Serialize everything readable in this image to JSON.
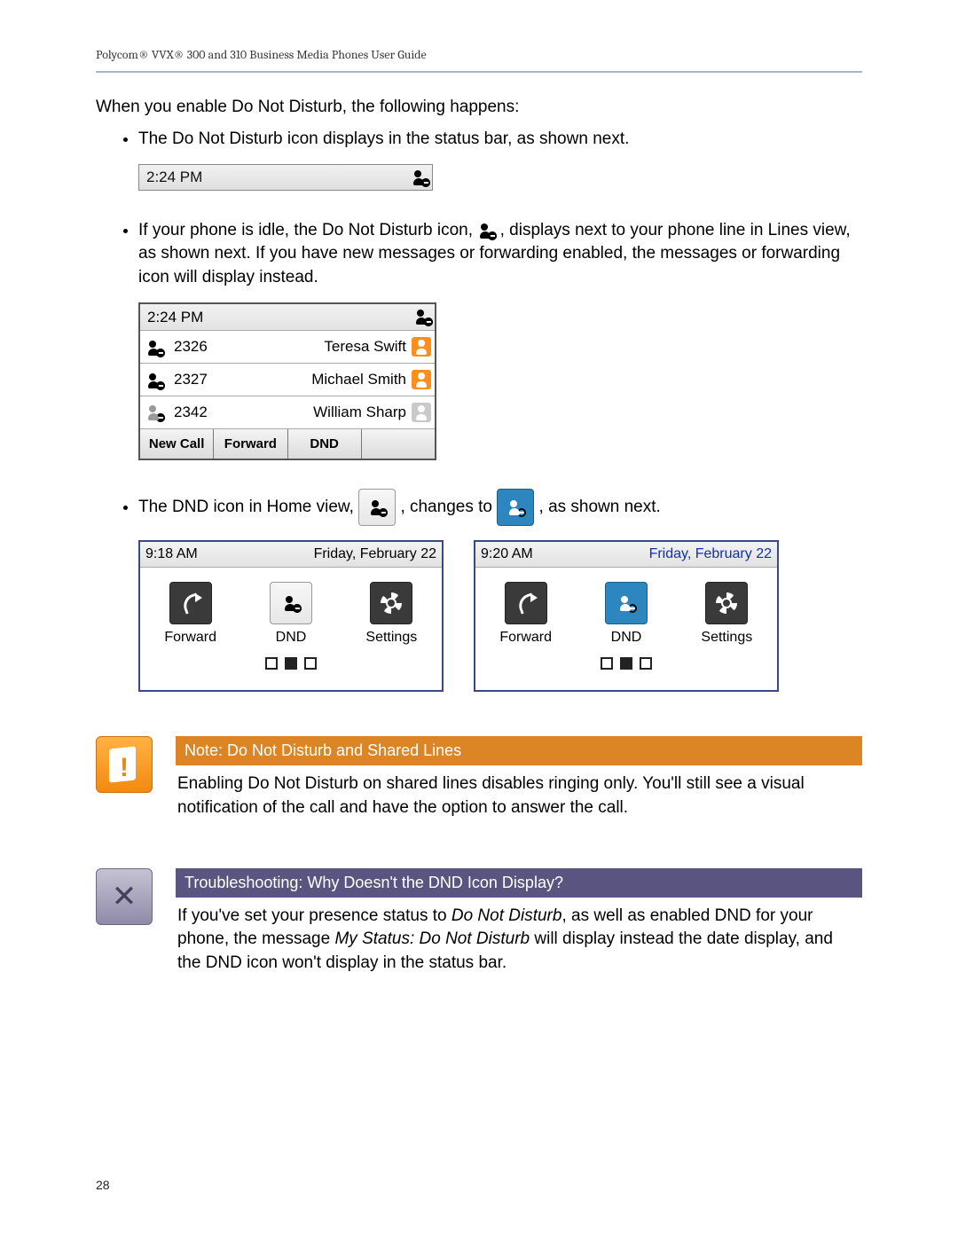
{
  "header": "Polycom® VVX® 300 and 310 Business Media Phones User Guide",
  "intro": "When you enable Do Not Disturb, the following happens:",
  "bullet1": "The Do Not Disturb icon displays in the status bar, as shown next.",
  "statusbar_time": "2:24 PM",
  "bullet2": {
    "pre": "If your phone is idle, the Do Not Disturb icon, ",
    "post": ", displays next to your phone line in Lines view, as shown next. If you have new messages or forwarding enabled, the messages or forwarding icon will display instead."
  },
  "lines_view": {
    "time": "2:24 PM",
    "rows": [
      {
        "ext": "2326",
        "name": "Teresa Swift",
        "contact_color": "orange"
      },
      {
        "ext": "2327",
        "name": "Michael Smith",
        "contact_color": "orange"
      },
      {
        "ext": "2342",
        "name": "William Sharp",
        "contact_color": "gray"
      }
    ],
    "softkeys": [
      "New Call",
      "Forward",
      "DND",
      ""
    ]
  },
  "bullet3": {
    "pre": "The DND icon in Home view, ",
    "mid": ", changes to ",
    "post": ", as shown next."
  },
  "home_left": {
    "time": "9:18 AM",
    "date": "Friday, February 22",
    "items": [
      "Forward",
      "DND",
      "Settings"
    ]
  },
  "home_right": {
    "time": "9:20 AM",
    "date": "Friday, February 22",
    "items": [
      "Forward",
      "DND",
      "Settings"
    ]
  },
  "note": {
    "title": "Note: Do Not Disturb and Shared Lines",
    "body": "Enabling Do Not Disturb on shared lines disables ringing only. You'll still see a visual notification of the call and have the option to answer the call."
  },
  "trouble": {
    "title": "Troubleshooting: Why Doesn't the DND Icon Display?",
    "body_pre": "If you've set your presence status to ",
    "body_em1": "Do Not Disturb",
    "body_mid": ", as well as enabled DND for your phone, the message ",
    "body_em2": "My Status: Do Not Disturb",
    "body_post": " will display instead the date display, and the DND icon won't display in the status bar."
  },
  "page_number": "28"
}
